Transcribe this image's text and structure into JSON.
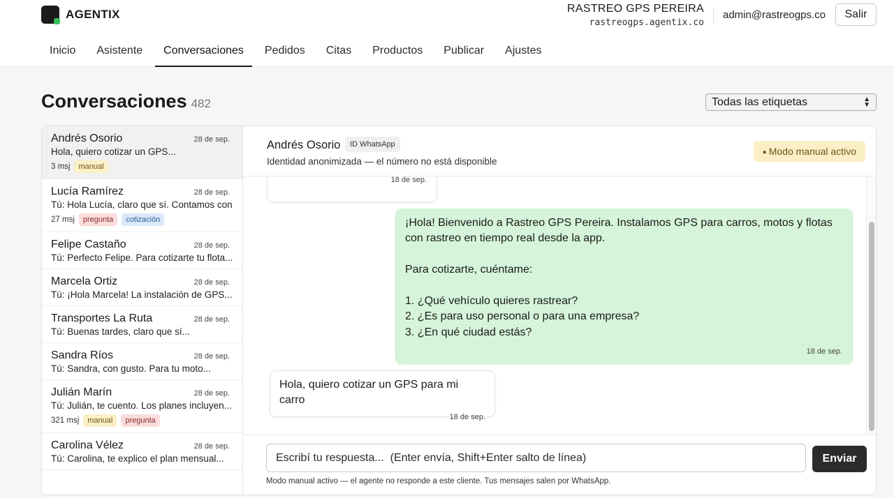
{
  "header": {
    "brand": "AGENTIX",
    "account_name": "RASTREO GPS PEREIRA",
    "account_domain": "rastreogps.agentix.co",
    "user_email": "admin@rastreogps.co",
    "logout_label": "Salir",
    "nav": [
      {
        "label": "Inicio"
      },
      {
        "label": "Asistente"
      },
      {
        "label": "Conversaciones",
        "active": true
      },
      {
        "label": "Pedidos"
      },
      {
        "label": "Citas"
      },
      {
        "label": "Productos"
      },
      {
        "label": "Publicar"
      },
      {
        "label": "Ajustes"
      }
    ]
  },
  "page": {
    "title": "Conversaciones",
    "count": "482",
    "filter_value": "Todas las etiquetas"
  },
  "conversations": [
    {
      "name": "Andrés Osorio",
      "date": "28 de sep.",
      "preview": "Hola, quiero cotizar un GPS...",
      "count": "3 msj",
      "tags": [
        "manual"
      ],
      "active": true
    },
    {
      "name": "Lucía Ramírez",
      "date": "28 de sep.",
      "preview": "Tú: Hola Lucía, claro que sí. Contamos con...",
      "count": "27 msj",
      "tags": [
        "pregunta",
        "cotización"
      ]
    },
    {
      "name": "Felipe Castaño",
      "date": "28 de sep.",
      "preview": "Tú: Perfecto Felipe. Para cotizarte tu flota...",
      "count": "",
      "tags": []
    },
    {
      "name": "Marcela Ortiz",
      "date": "28 de sep.",
      "preview": "Tú: ¡Hola Marcela! La instalación de GPS...",
      "count": "",
      "tags": []
    },
    {
      "name": "Transportes La Ruta",
      "date": "28 de sep.",
      "preview": "Tú: Buenas tardes, claro que sí...",
      "count": "",
      "tags": []
    },
    {
      "name": "Sandra Ríos",
      "date": "28 de sep.",
      "preview": "Tú: Sandra, con gusto. Para tu moto...",
      "count": "",
      "tags": []
    },
    {
      "name": "Julián Marín",
      "date": "28 de sep.",
      "preview": "Tú: Julián, te cuento. Los planes incluyen...",
      "count": "321 msj",
      "tags": [
        "manual",
        "pregunta"
      ]
    },
    {
      "name": "Carolina Vélez",
      "date": "28 de sep.",
      "preview": "Tú: Carolina, te explico el plan mensual...",
      "count": "",
      "tags": []
    }
  ],
  "chat": {
    "contact_name": "Andrés Osorio",
    "id_badge": "ID WhatsApp",
    "subtitle": "Identidad anonimizada — el número no está disponible",
    "mode_badge": "Modo manual activo",
    "messages": {
      "old_time": "18 de sep.",
      "bot_text": "¡Hola! Bienvenido a Rastreo GPS Pereira. Instalamos GPS para carros, motos y flotas\ncon rastreo en tiempo real desde la app.\n\nPara cotizarte, cuéntame:\n\n1. ¿Qué vehículo quieres rastrear?\n2. ¿Es para uso personal o para una empresa?\n3. ¿En qué ciudad estás?",
      "bot_time": "18 de sep.",
      "user_text": "Hola, quiero cotizar un GPS para mi carro",
      "user_time": "18 de sep."
    },
    "composer": {
      "placeholder": "Escribí tu respuesta...  (Enter envía, Shift+Enter salto de línea)",
      "send_label": "Enviar",
      "note": "Modo manual activo — el agente no responde a este cliente. Tus mensajes salen por WhatsApp."
    }
  }
}
